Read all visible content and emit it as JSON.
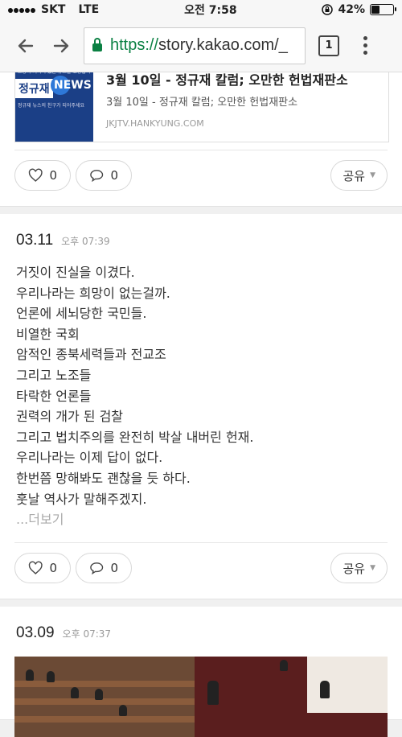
{
  "status_bar": {
    "carrier": "SKT",
    "network": "LTE",
    "time": "오전 7:58",
    "battery": "42%",
    "battery_level": 0.42
  },
  "browser": {
    "url_scheme": "https://",
    "url_host": "story.kakao.com/_",
    "tab_count": "1"
  },
  "feed": {
    "post1": {
      "link": {
        "thumb_sub": "교양과 지식이 있는 뉴스를 표방합니다.",
        "thumb_brand": "정규재",
        "thumb_brand2": "NEWS",
        "thumb_tag": "정규재 뉴스의 친구가 되어주세요",
        "title": "3월 10일 - 정규재 칼럼; 오만한 헌법재판소",
        "description": "3월 10일 - 정규재 칼럼; 오만한 헌법재판소",
        "domain": "JKJTV.HANKYUNG.COM"
      },
      "like_count": "0",
      "comment_count": "0",
      "share_label": "공유"
    },
    "post2": {
      "date": "03.11",
      "time": "오후 07:39",
      "lines": [
        "거짓이 진실을 이겼다.",
        "우리나라는 희망이 없는걸까.",
        "언론에 세뇌당한 국민들.",
        "비열한 국회",
        "암적인 종북세력들과 전교조",
        "그리고 노조들",
        "타락한 언론들",
        "권력의 개가 된 검찰",
        "그리고 법치주의를 완전히 박살 내버린 헌재.",
        "우리나라는 이제 답이 없다.",
        "한번쯤 망해봐도 괜찮을 듯 하다.",
        "훗날 역사가 말해주겠지."
      ],
      "more": "...더보기",
      "like_count": "0",
      "comment_count": "0",
      "share_label": "공유"
    },
    "post3": {
      "date": "03.09",
      "time": "오후 07:37"
    }
  }
}
